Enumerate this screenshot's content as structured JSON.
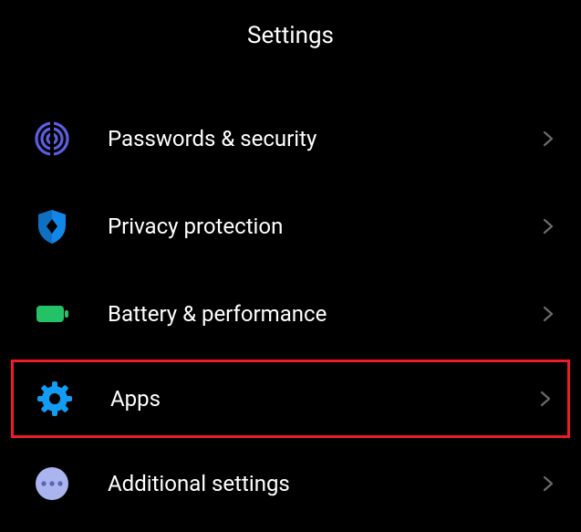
{
  "header": {
    "title": "Settings"
  },
  "items": [
    {
      "label": "Passwords & security"
    },
    {
      "label": "Privacy protection"
    },
    {
      "label": "Battery & performance"
    },
    {
      "label": "Apps"
    },
    {
      "label": "Additional settings"
    }
  ]
}
